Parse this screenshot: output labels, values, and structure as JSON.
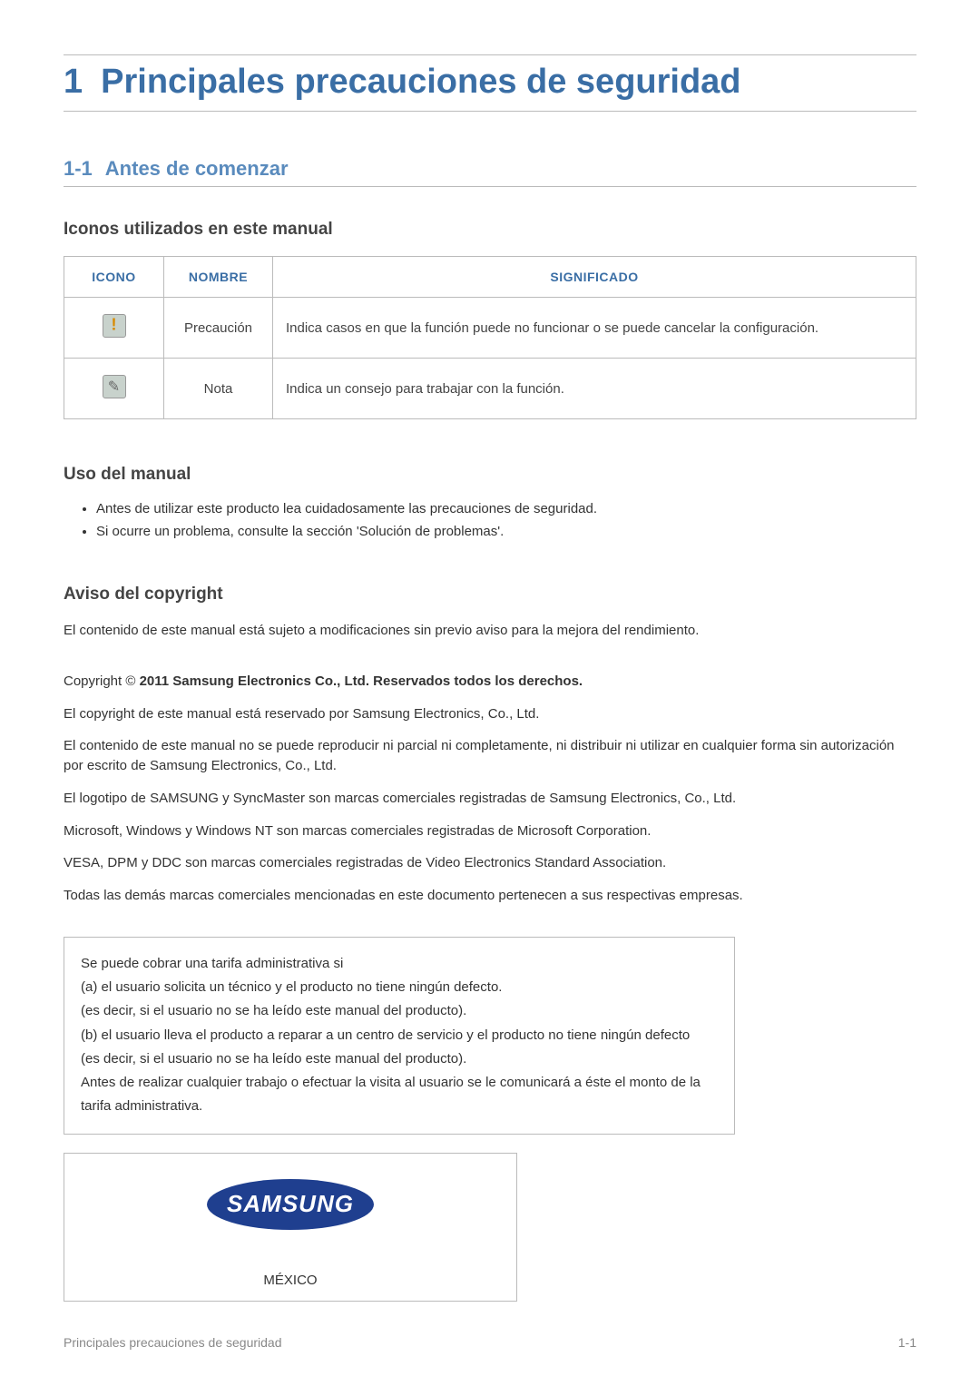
{
  "chapter": {
    "number": "1",
    "title": "Principales precauciones de seguridad"
  },
  "section": {
    "number": "1-1",
    "title": "Antes de comenzar"
  },
  "icons_section": {
    "heading": "Iconos utilizados en este manual",
    "headers": {
      "icon": "ICONO",
      "name": "NOMBRE",
      "meaning": "SIGNIFICADO"
    },
    "rows": [
      {
        "name": "Precaución",
        "meaning": "Indica casos en que la función puede no funcionar o se puede cancelar la configuración."
      },
      {
        "name": "Nota",
        "meaning": "Indica un consejo para trabajar con la función."
      }
    ]
  },
  "manual_use": {
    "heading": "Uso del manual",
    "items": [
      "Antes de utilizar este producto lea cuidadosamente las precauciones de seguridad.",
      "Si ocurre un problema, consulte la sección 'Solución de problemas'."
    ]
  },
  "copyright": {
    "heading": "Aviso del copyright",
    "intro": "El contenido de este manual está sujeto a modificaciones sin previo aviso para la mejora del rendimiento.",
    "line_prefix": "Copyright © ",
    "line_bold": "2011 Samsung Electronics Co., Ltd. Reservados todos los derechos.",
    "paragraphs": [
      "El copyright de este manual está reservado por Samsung Electronics, Co., Ltd.",
      "El contenido de este manual no se puede reproducir ni parcial ni completamente, ni distribuir ni utilizar en cualquier forma sin autorización por escrito de Samsung Electronics, Co., Ltd.",
      "El logotipo de SAMSUNG y SyncMaster son marcas comerciales registradas de Samsung Electronics, Co., Ltd.",
      "Microsoft, Windows y Windows NT son marcas comerciales registradas de Microsoft Corporation.",
      "VESA, DPM y DDC son marcas comerciales registradas de Video Electronics Standard Association.",
      "Todas las demás marcas comerciales mencionadas en este documento pertenecen a sus respectivas empresas."
    ]
  },
  "fee_box": {
    "lines": [
      "Se puede cobrar una tarifa administrativa si",
      "(a) el usuario solicita un técnico y el producto no tiene ningún defecto.",
      "(es decir, si el usuario no se ha leído este manual del producto).",
      "(b) el usuario lleva el producto a reparar a un centro de servicio y el producto no tiene ningún defecto",
      "(es decir, si el usuario no se ha leído este manual del producto).",
      "Antes de realizar cualquier trabajo o efectuar la visita al usuario se le comunicará a éste el monto de la tarifa administrativa."
    ]
  },
  "region_box": {
    "logo_text": "SAMSUNG",
    "region": "MÉXICO"
  },
  "footer": {
    "left": "Principales precauciones de seguridad",
    "right": "1-1"
  },
  "chart_data": {
    "type": "table",
    "title": "Iconos utilizados en este manual",
    "columns": [
      "ICONO",
      "NOMBRE",
      "SIGNIFICADO"
    ],
    "rows": [
      [
        "caution-icon",
        "Precaución",
        "Indica casos en que la función puede no funcionar o se puede cancelar la configuración."
      ],
      [
        "note-icon",
        "Nota",
        "Indica un consejo para trabajar con la función."
      ]
    ]
  }
}
